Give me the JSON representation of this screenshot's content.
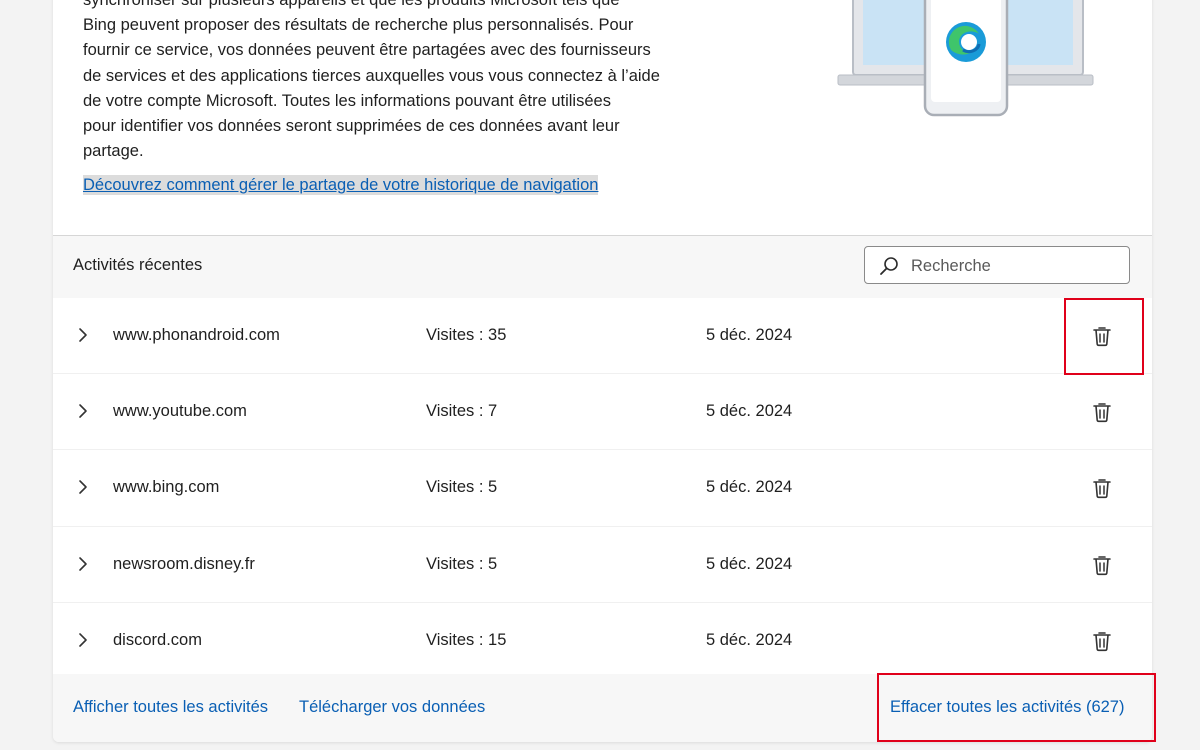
{
  "intro": {
    "paragraph": [
      "synchroniser sur plusieurs appareils et que les produits Microsoft tels que",
      "Bing peuvent proposer des résultats de recherche plus personnalisés. Pour",
      "fournir ce service, vos données peuvent être partagées avec des fournisseurs",
      "de services et des applications tierces auxquelles vous vous connectez à l’aide",
      "de votre compte Microsoft. Toutes les informations pouvant être utilisées",
      "pour identifier vos données seront supprimées de ces données avant leur",
      "partage."
    ],
    "link": "Découvrez comment gérer le partage de votre historique de navigation"
  },
  "activity": {
    "title": "Activités récentes",
    "search_placeholder": "Recherche",
    "rows": [
      {
        "site": "www.phonandroid.com",
        "visits": "Visites : 35",
        "date": "5 déc. 2024"
      },
      {
        "site": "www.youtube.com",
        "visits": "Visites : 7",
        "date": "5 déc. 2024"
      },
      {
        "site": "www.bing.com",
        "visits": "Visites : 5",
        "date": "5 déc. 2024"
      },
      {
        "site": "newsroom.disney.fr",
        "visits": "Visites : 5",
        "date": "5 déc. 2024"
      },
      {
        "site": "discord.com",
        "visits": "Visites : 15",
        "date": "5 déc. 2024"
      }
    ]
  },
  "footer": {
    "show_all": "Afficher toutes les activités",
    "download": "Télécharger vos données",
    "clear_all": "Effacer toutes les activités (627)"
  },
  "icons": {
    "row_expand": "chevron-right-icon",
    "row_delete": "trash-icon",
    "search": "search-icon",
    "illustration": "edge-logo"
  },
  "colors": {
    "link": "#0a5fb4",
    "highlight": "#e0001a",
    "background": "#f3f3f3"
  }
}
